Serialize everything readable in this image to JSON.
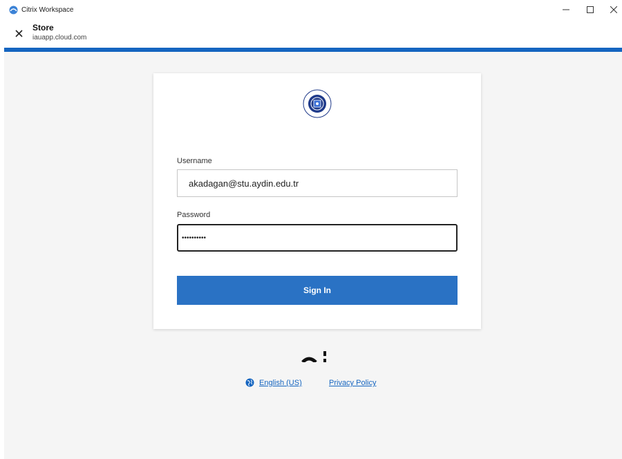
{
  "window": {
    "app_title": "Citrix Workspace",
    "app_icon": "citrix-workspace-icon",
    "controls": [
      "minimize-icon",
      "maximize-icon",
      "close-icon"
    ]
  },
  "store": {
    "title": "Store",
    "url": "iauapp.cloud.com",
    "close_icon": "close-icon"
  },
  "colors": {
    "accent": "#1565c0",
    "button": "#2a72c4",
    "background": "#f5f5f5",
    "link": "#1565c0"
  },
  "login": {
    "logo": "istanbul-aydin-university-seal",
    "username_label": "Username",
    "username_value": "akadagan@stu.aydin.edu.tr",
    "password_label": "Password",
    "password_value": "••••••••••",
    "signin_label": "Sign In"
  },
  "footer": {
    "language_icon": "globe-icon",
    "language_label": "English (US)",
    "privacy_label": "Privacy Policy"
  }
}
